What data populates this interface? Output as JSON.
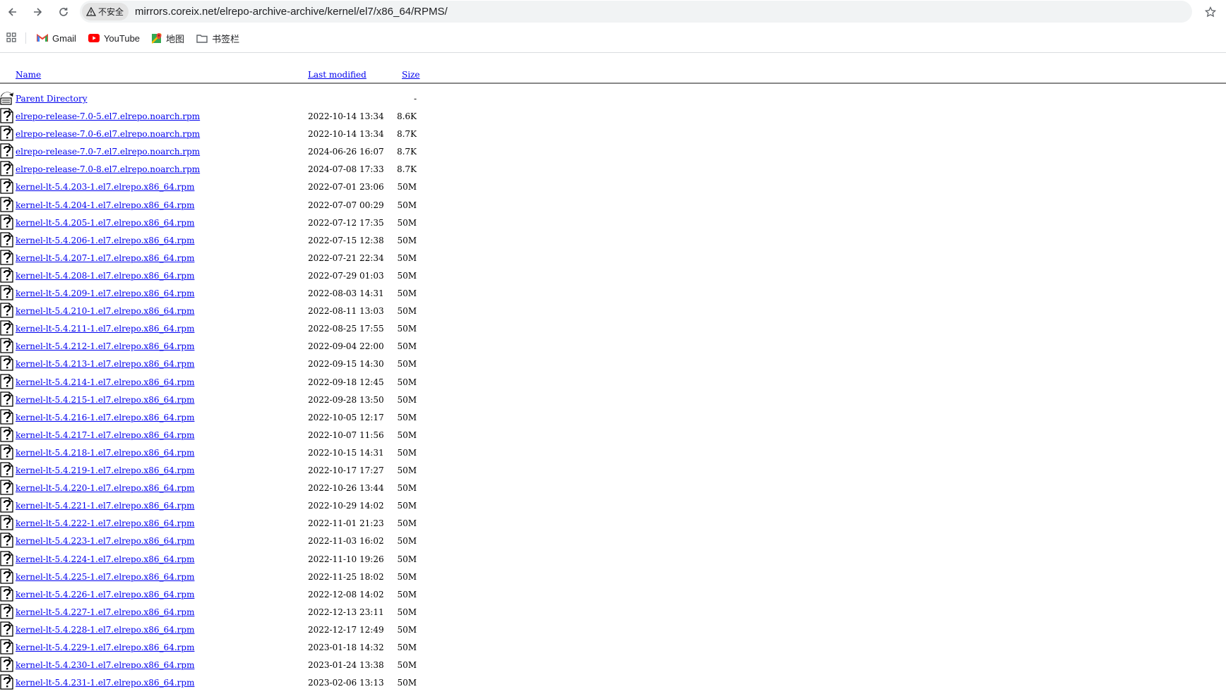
{
  "browser": {
    "security_label": "不安全",
    "url": "mirrors.coreix.net/elrepo-archive-archive/kernel/el7/x86_64/RPMS/",
    "bookmarks": [
      {
        "label": "Gmail",
        "icon": "gmail-icon"
      },
      {
        "label": "YouTube",
        "icon": "youtube-icon"
      },
      {
        "label": "地图",
        "icon": "maps-icon"
      },
      {
        "label": "书签栏",
        "icon": "folder-icon"
      }
    ]
  },
  "listing": {
    "columns": {
      "name": "Name",
      "modified": "Last modified",
      "size": "Size"
    },
    "parent": {
      "name": "Parent Directory",
      "size": "-"
    },
    "rows": [
      {
        "name": "elrepo-release-7.0-5.el7.elrepo.noarch.rpm",
        "modified": "2022-10-14 13:34",
        "size": "8.6K"
      },
      {
        "name": "elrepo-release-7.0-6.el7.elrepo.noarch.rpm",
        "modified": "2022-10-14 13:34",
        "size": "8.7K"
      },
      {
        "name": "elrepo-release-7.0-7.el7.elrepo.noarch.rpm",
        "modified": "2024-06-26 16:07",
        "size": "8.7K"
      },
      {
        "name": "elrepo-release-7.0-8.el7.elrepo.noarch.rpm",
        "modified": "2024-07-08 17:33",
        "size": "8.7K"
      },
      {
        "name": "kernel-lt-5.4.203-1.el7.elrepo.x86_64.rpm",
        "modified": "2022-07-01 23:06",
        "size": "50M"
      },
      {
        "name": "kernel-lt-5.4.204-1.el7.elrepo.x86_64.rpm",
        "modified": "2022-07-07 00:29",
        "size": "50M"
      },
      {
        "name": "kernel-lt-5.4.205-1.el7.elrepo.x86_64.rpm",
        "modified": "2022-07-12 17:35",
        "size": "50M"
      },
      {
        "name": "kernel-lt-5.4.206-1.el7.elrepo.x86_64.rpm",
        "modified": "2022-07-15 12:38",
        "size": "50M"
      },
      {
        "name": "kernel-lt-5.4.207-1.el7.elrepo.x86_64.rpm",
        "modified": "2022-07-21 22:34",
        "size": "50M"
      },
      {
        "name": "kernel-lt-5.4.208-1.el7.elrepo.x86_64.rpm",
        "modified": "2022-07-29 01:03",
        "size": "50M"
      },
      {
        "name": "kernel-lt-5.4.209-1.el7.elrepo.x86_64.rpm",
        "modified": "2022-08-03 14:31",
        "size": "50M"
      },
      {
        "name": "kernel-lt-5.4.210-1.el7.elrepo.x86_64.rpm",
        "modified": "2022-08-11 13:03",
        "size": "50M"
      },
      {
        "name": "kernel-lt-5.4.211-1.el7.elrepo.x86_64.rpm",
        "modified": "2022-08-25 17:55",
        "size": "50M"
      },
      {
        "name": "kernel-lt-5.4.212-1.el7.elrepo.x86_64.rpm",
        "modified": "2022-09-04 22:00",
        "size": "50M"
      },
      {
        "name": "kernel-lt-5.4.213-1.el7.elrepo.x86_64.rpm",
        "modified": "2022-09-15 14:30",
        "size": "50M"
      },
      {
        "name": "kernel-lt-5.4.214-1.el7.elrepo.x86_64.rpm",
        "modified": "2022-09-18 12:45",
        "size": "50M"
      },
      {
        "name": "kernel-lt-5.4.215-1.el7.elrepo.x86_64.rpm",
        "modified": "2022-09-28 13:50",
        "size": "50M"
      },
      {
        "name": "kernel-lt-5.4.216-1.el7.elrepo.x86_64.rpm",
        "modified": "2022-10-05 12:17",
        "size": "50M"
      },
      {
        "name": "kernel-lt-5.4.217-1.el7.elrepo.x86_64.rpm",
        "modified": "2022-10-07 11:56",
        "size": "50M"
      },
      {
        "name": "kernel-lt-5.4.218-1.el7.elrepo.x86_64.rpm",
        "modified": "2022-10-15 14:31",
        "size": "50M"
      },
      {
        "name": "kernel-lt-5.4.219-1.el7.elrepo.x86_64.rpm",
        "modified": "2022-10-17 17:27",
        "size": "50M"
      },
      {
        "name": "kernel-lt-5.4.220-1.el7.elrepo.x86_64.rpm",
        "modified": "2022-10-26 13:44",
        "size": "50M"
      },
      {
        "name": "kernel-lt-5.4.221-1.el7.elrepo.x86_64.rpm",
        "modified": "2022-10-29 14:02",
        "size": "50M"
      },
      {
        "name": "kernel-lt-5.4.222-1.el7.elrepo.x86_64.rpm",
        "modified": "2022-11-01 21:23",
        "size": "50M"
      },
      {
        "name": "kernel-lt-5.4.223-1.el7.elrepo.x86_64.rpm",
        "modified": "2022-11-03 16:02",
        "size": "50M"
      },
      {
        "name": "kernel-lt-5.4.224-1.el7.elrepo.x86_64.rpm",
        "modified": "2022-11-10 19:26",
        "size": "50M"
      },
      {
        "name": "kernel-lt-5.4.225-1.el7.elrepo.x86_64.rpm",
        "modified": "2022-11-25 18:02",
        "size": "50M"
      },
      {
        "name": "kernel-lt-5.4.226-1.el7.elrepo.x86_64.rpm",
        "modified": "2022-12-08 14:02",
        "size": "50M"
      },
      {
        "name": "kernel-lt-5.4.227-1.el7.elrepo.x86_64.rpm",
        "modified": "2022-12-13 23:11",
        "size": "50M"
      },
      {
        "name": "kernel-lt-5.4.228-1.el7.elrepo.x86_64.rpm",
        "modified": "2022-12-17 12:49",
        "size": "50M"
      },
      {
        "name": "kernel-lt-5.4.229-1.el7.elrepo.x86_64.rpm",
        "modified": "2023-01-18 14:32",
        "size": "50M"
      },
      {
        "name": "kernel-lt-5.4.230-1.el7.elrepo.x86_64.rpm",
        "modified": "2023-01-24 13:38",
        "size": "50M"
      },
      {
        "name": "kernel-lt-5.4.231-1.el7.elrepo.x86_64.rpm",
        "modified": "2023-02-06 13:13",
        "size": "50M"
      }
    ]
  }
}
